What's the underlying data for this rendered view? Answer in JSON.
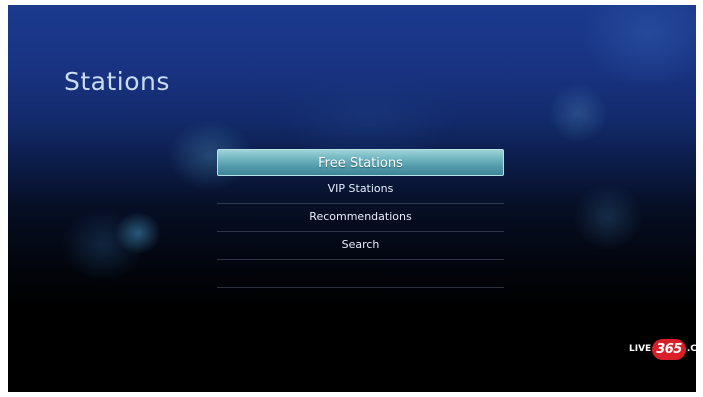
{
  "page": {
    "title": "Stations"
  },
  "menu": {
    "items": [
      {
        "label": "Free Stations",
        "selected": true
      },
      {
        "label": "VIP Stations",
        "selected": false
      },
      {
        "label": "Recommendations",
        "selected": false
      },
      {
        "label": "Search",
        "selected": false
      }
    ]
  },
  "logo": {
    "prefix": "LIVE",
    "number": "365",
    "suffix": ".COM"
  },
  "colors": {
    "selection_highlight": "#6fb6c0",
    "background_top": "#1b3a8e",
    "logo_badge": "#d9202a"
  }
}
